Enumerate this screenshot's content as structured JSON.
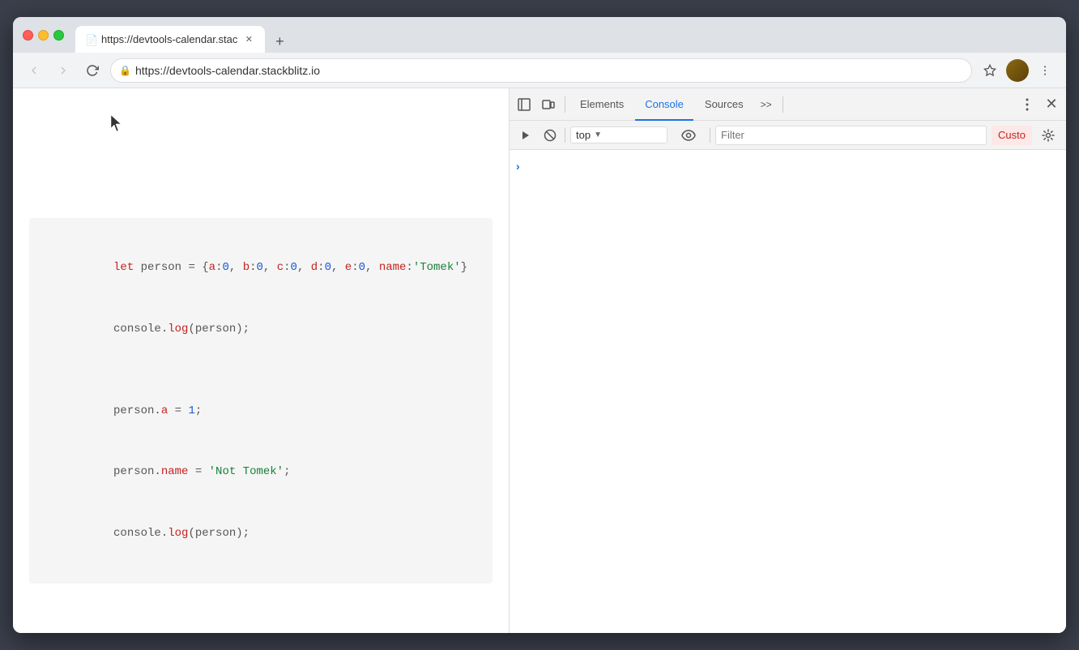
{
  "browser": {
    "tab": {
      "title": "https://devtools-calendar.stac",
      "favicon": "📄"
    },
    "address": "https://devtools-calendar.stackblitz.io",
    "new_tab_label": "+"
  },
  "nav": {
    "back_label": "←",
    "forward_label": "→",
    "reload_label": "↻"
  },
  "address_bar": {
    "lock_icon": "🔒",
    "url": "https://devtools-calendar.stackblitz.io",
    "bookmark_label": "☆",
    "more_label": "⋮"
  },
  "code": {
    "line1": "let person = {a:0, b:0, c:0, d:0, e:0, name:'Tomek'}",
    "line2": "console.log(person);",
    "line3": "",
    "line4": "person.a = 1;",
    "line5": "person.name = 'Not Tomek';",
    "line6": "console.log(person);"
  },
  "devtools": {
    "tabs": {
      "elements": "Elements",
      "console": "Console",
      "sources": "Sources",
      "more": ">>"
    },
    "toolbar": {
      "context_top": "top",
      "filter_placeholder": "Filter",
      "custom_label": "Custo"
    },
    "console_prompt": ">"
  }
}
